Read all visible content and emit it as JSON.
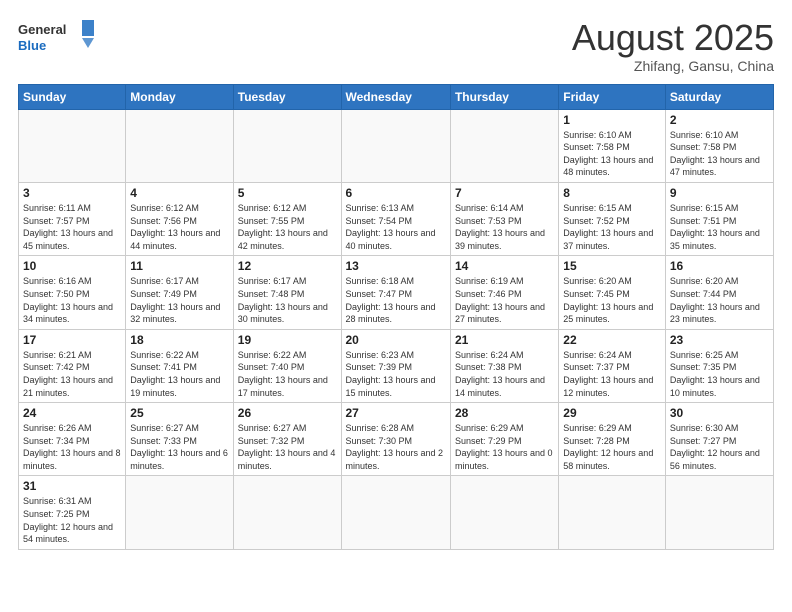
{
  "header": {
    "logo_general": "General",
    "logo_blue": "Blue",
    "month_title": "August 2025",
    "location": "Zhifang, Gansu, China"
  },
  "weekdays": [
    "Sunday",
    "Monday",
    "Tuesday",
    "Wednesday",
    "Thursday",
    "Friday",
    "Saturday"
  ],
  "weeks": [
    [
      {
        "day": "",
        "info": ""
      },
      {
        "day": "",
        "info": ""
      },
      {
        "day": "",
        "info": ""
      },
      {
        "day": "",
        "info": ""
      },
      {
        "day": "",
        "info": ""
      },
      {
        "day": "1",
        "info": "Sunrise: 6:10 AM\nSunset: 7:58 PM\nDaylight: 13 hours\nand 48 minutes."
      },
      {
        "day": "2",
        "info": "Sunrise: 6:10 AM\nSunset: 7:58 PM\nDaylight: 13 hours\nand 47 minutes."
      }
    ],
    [
      {
        "day": "3",
        "info": "Sunrise: 6:11 AM\nSunset: 7:57 PM\nDaylight: 13 hours\nand 45 minutes."
      },
      {
        "day": "4",
        "info": "Sunrise: 6:12 AM\nSunset: 7:56 PM\nDaylight: 13 hours\nand 44 minutes."
      },
      {
        "day": "5",
        "info": "Sunrise: 6:12 AM\nSunset: 7:55 PM\nDaylight: 13 hours\nand 42 minutes."
      },
      {
        "day": "6",
        "info": "Sunrise: 6:13 AM\nSunset: 7:54 PM\nDaylight: 13 hours\nand 40 minutes."
      },
      {
        "day": "7",
        "info": "Sunrise: 6:14 AM\nSunset: 7:53 PM\nDaylight: 13 hours\nand 39 minutes."
      },
      {
        "day": "8",
        "info": "Sunrise: 6:15 AM\nSunset: 7:52 PM\nDaylight: 13 hours\nand 37 minutes."
      },
      {
        "day": "9",
        "info": "Sunrise: 6:15 AM\nSunset: 7:51 PM\nDaylight: 13 hours\nand 35 minutes."
      }
    ],
    [
      {
        "day": "10",
        "info": "Sunrise: 6:16 AM\nSunset: 7:50 PM\nDaylight: 13 hours\nand 34 minutes."
      },
      {
        "day": "11",
        "info": "Sunrise: 6:17 AM\nSunset: 7:49 PM\nDaylight: 13 hours\nand 32 minutes."
      },
      {
        "day": "12",
        "info": "Sunrise: 6:17 AM\nSunset: 7:48 PM\nDaylight: 13 hours\nand 30 minutes."
      },
      {
        "day": "13",
        "info": "Sunrise: 6:18 AM\nSunset: 7:47 PM\nDaylight: 13 hours\nand 28 minutes."
      },
      {
        "day": "14",
        "info": "Sunrise: 6:19 AM\nSunset: 7:46 PM\nDaylight: 13 hours\nand 27 minutes."
      },
      {
        "day": "15",
        "info": "Sunrise: 6:20 AM\nSunset: 7:45 PM\nDaylight: 13 hours\nand 25 minutes."
      },
      {
        "day": "16",
        "info": "Sunrise: 6:20 AM\nSunset: 7:44 PM\nDaylight: 13 hours\nand 23 minutes."
      }
    ],
    [
      {
        "day": "17",
        "info": "Sunrise: 6:21 AM\nSunset: 7:42 PM\nDaylight: 13 hours\nand 21 minutes."
      },
      {
        "day": "18",
        "info": "Sunrise: 6:22 AM\nSunset: 7:41 PM\nDaylight: 13 hours\nand 19 minutes."
      },
      {
        "day": "19",
        "info": "Sunrise: 6:22 AM\nSunset: 7:40 PM\nDaylight: 13 hours\nand 17 minutes."
      },
      {
        "day": "20",
        "info": "Sunrise: 6:23 AM\nSunset: 7:39 PM\nDaylight: 13 hours\nand 15 minutes."
      },
      {
        "day": "21",
        "info": "Sunrise: 6:24 AM\nSunset: 7:38 PM\nDaylight: 13 hours\nand 14 minutes."
      },
      {
        "day": "22",
        "info": "Sunrise: 6:24 AM\nSunset: 7:37 PM\nDaylight: 13 hours\nand 12 minutes."
      },
      {
        "day": "23",
        "info": "Sunrise: 6:25 AM\nSunset: 7:35 PM\nDaylight: 13 hours\nand 10 minutes."
      }
    ],
    [
      {
        "day": "24",
        "info": "Sunrise: 6:26 AM\nSunset: 7:34 PM\nDaylight: 13 hours\nand 8 minutes."
      },
      {
        "day": "25",
        "info": "Sunrise: 6:27 AM\nSunset: 7:33 PM\nDaylight: 13 hours\nand 6 minutes."
      },
      {
        "day": "26",
        "info": "Sunrise: 6:27 AM\nSunset: 7:32 PM\nDaylight: 13 hours\nand 4 minutes."
      },
      {
        "day": "27",
        "info": "Sunrise: 6:28 AM\nSunset: 7:30 PM\nDaylight: 13 hours\nand 2 minutes."
      },
      {
        "day": "28",
        "info": "Sunrise: 6:29 AM\nSunset: 7:29 PM\nDaylight: 13 hours\nand 0 minutes."
      },
      {
        "day": "29",
        "info": "Sunrise: 6:29 AM\nSunset: 7:28 PM\nDaylight: 12 hours\nand 58 minutes."
      },
      {
        "day": "30",
        "info": "Sunrise: 6:30 AM\nSunset: 7:27 PM\nDaylight: 12 hours\nand 56 minutes."
      }
    ],
    [
      {
        "day": "31",
        "info": "Sunrise: 6:31 AM\nSunset: 7:25 PM\nDaylight: 12 hours\nand 54 minutes."
      },
      {
        "day": "",
        "info": ""
      },
      {
        "day": "",
        "info": ""
      },
      {
        "day": "",
        "info": ""
      },
      {
        "day": "",
        "info": ""
      },
      {
        "day": "",
        "info": ""
      },
      {
        "day": "",
        "info": ""
      }
    ]
  ]
}
